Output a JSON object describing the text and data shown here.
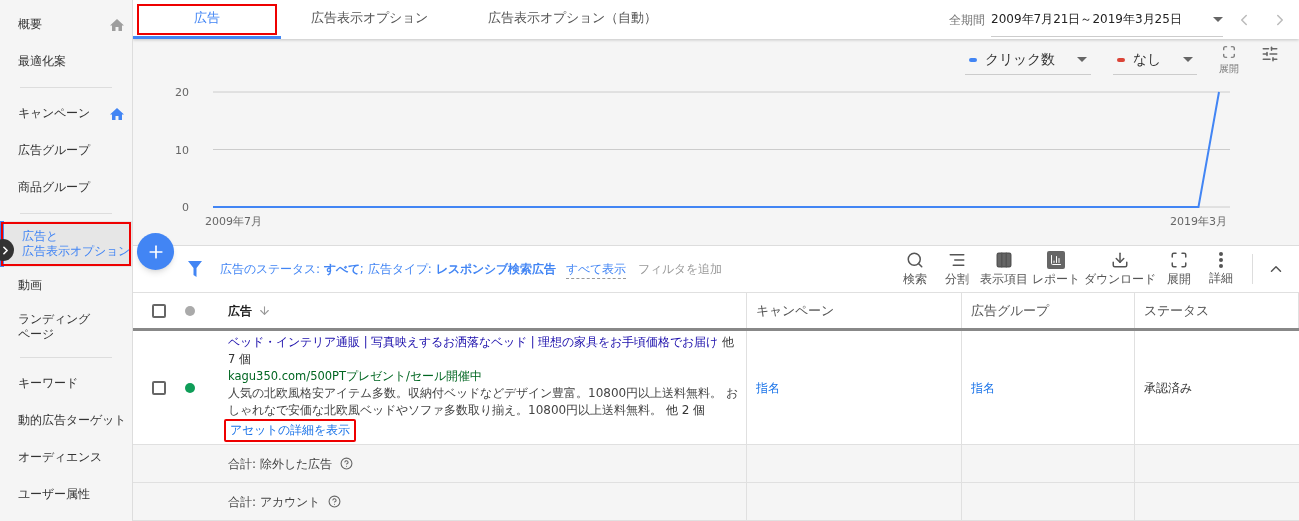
{
  "sidebar": {
    "sections": [
      {
        "items": [
          {
            "lines": [
              "概要"
            ],
            "selected": false,
            "highlighted": false,
            "color": "#9e9e9e"
          },
          {
            "lines": [
              "最適化案"
            ],
            "selected": false,
            "highlighted": false
          }
        ]
      },
      {
        "items": [
          {
            "lines": [
              "キャンペーン"
            ],
            "selected": false,
            "highlighted": false,
            "color": "#4285f4"
          },
          {
            "lines": [
              "広告グループ"
            ],
            "selected": false,
            "highlighted": false
          },
          {
            "lines": [
              "商品グループ"
            ],
            "selected": false,
            "highlighted": false
          }
        ]
      },
      {
        "items": [
          {
            "lines": [
              "広告と",
              "広告表示オプション"
            ],
            "selected": true,
            "highlighted": true
          },
          {
            "lines": [
              "動画"
            ],
            "selected": false,
            "highlighted": false
          },
          {
            "lines": [
              "ランディング",
              "ページ"
            ],
            "selected": false,
            "highlighted": false
          }
        ]
      },
      {
        "items": [
          {
            "lines": [
              "キーワード"
            ],
            "selected": false,
            "highlighted": false
          },
          {
            "lines": [
              "動的広告ターゲット"
            ],
            "selected": false,
            "highlighted": false
          },
          {
            "lines": [
              "オーディエンス"
            ],
            "selected": false,
            "highlighted": false
          },
          {
            "lines": [
              "ユーザー属性"
            ],
            "selected": false,
            "highlighted": false
          }
        ]
      }
    ]
  },
  "tabs": [
    {
      "label": "広告",
      "selected": true,
      "highlighted": true
    },
    {
      "label": "広告表示オプション",
      "selected": false,
      "highlighted": false
    },
    {
      "label": "広告表示オプション（自動）",
      "selected": false,
      "highlighted": false
    }
  ],
  "date_range": {
    "label": "全期間",
    "value": "2009年7月21日～2019年3月25日"
  },
  "chart_controls": {
    "metrics": [
      {
        "label": "クリック数",
        "color": "#4285f4"
      },
      {
        "label": "なし",
        "color": "#db4437"
      }
    ],
    "expand_label": "展開"
  },
  "chart_data": {
    "type": "line",
    "categories": [
      null,
      "2009年7月",
      null,
      null,
      null,
      null,
      null,
      null,
      null,
      null,
      null,
      null,
      null,
      null,
      null,
      null,
      null,
      null,
      null,
      null,
      null,
      null,
      null,
      null,
      null,
      null,
      null,
      null,
      null,
      null,
      null,
      null,
      null,
      null,
      null,
      null,
      null,
      null,
      null,
      null,
      null,
      null,
      null,
      null,
      null,
      null,
      null,
      null,
      "2019年3月",
      null
    ],
    "ylim": [
      0,
      20
    ],
    "yticks": [
      0,
      10,
      20
    ],
    "series": [
      {
        "color": "#4285f4",
        "values": [
          0,
          0,
          0,
          0,
          0,
          0,
          0,
          0,
          0,
          0,
          0,
          0,
          0,
          0,
          0,
          0,
          0,
          0,
          0,
          0,
          0,
          0,
          0,
          0,
          0,
          0,
          0,
          0,
          0,
          0,
          0,
          0,
          0,
          0,
          0,
          0,
          0,
          0,
          0,
          0,
          0,
          0,
          0,
          0,
          0,
          0,
          0,
          0,
          0,
          20
        ]
      }
    ]
  },
  "filter_bar": {
    "filters": "広告のステータス: **すべて**; 広告タイプ: **レスポンシブ検索広告**",
    "show_all": "すべて表示",
    "add_filter": "フィルタを追加"
  },
  "toolbar": [
    {
      "label": "検索",
      "kind": "search"
    },
    {
      "label": "分割",
      "kind": "segment"
    },
    {
      "label": "表示項目",
      "kind": "columns"
    },
    {
      "label": "レポート",
      "kind": "report"
    },
    {
      "label": "ダウンロード",
      "kind": "download"
    },
    {
      "label": "展開",
      "kind": "expand"
    },
    {
      "label": "詳細",
      "kind": "more"
    }
  ],
  "table": {
    "select_all_checked": false,
    "columns": [
      {
        "label": "広告",
        "sorted": true
      },
      {
        "label": "キャンペーン",
        "sorted": false
      },
      {
        "label": "広告グループ",
        "sorted": false
      },
      {
        "label": "ステータス",
        "sorted": false
      }
    ],
    "rows": [
      {
        "checked": false,
        "color": "#0f9d58",
        "headline": "ベッド・インテリア通販 | 写真映えするお洒落なベッド | 理想の家具をお手頃価格でお届け",
        "headline_more": "他 7 個",
        "url": "kagu350.com/500PTプレゼント/セール開催中",
        "description": "人気の北欧風格安アイテム多数。収納付ベッドなどデザイン豊富。10800円以上送料無料。 おしゃれなで安価な北欧風ベッドやソファ多数取り揃え。10800円以上送料無料。",
        "description_more": "他 2 個",
        "asset_link": "アセットの詳細を表示",
        "asset_link_highlighted": true,
        "campaign": "指名",
        "ad_group": "指名",
        "status": "承認済み"
      }
    ],
    "summary_rows": [
      {
        "label": "合計: 除外した広告"
      },
      {
        "label": "合計: アカウント"
      }
    ]
  }
}
